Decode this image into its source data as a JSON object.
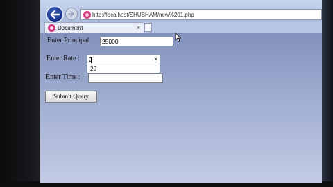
{
  "browser": {
    "url": "http://localhost/SHUBHAM/new%201.php",
    "tab": {
      "title": "Document",
      "close": "×"
    }
  },
  "form": {
    "principal": {
      "label": "Enter Principal",
      "value": "25000"
    },
    "rate": {
      "label": "Enter Rate :",
      "value": "2",
      "clear": "×",
      "suggestion": "20"
    },
    "time": {
      "label": "Enter Time :",
      "value": ""
    },
    "submit_label": "Submit Query"
  }
}
